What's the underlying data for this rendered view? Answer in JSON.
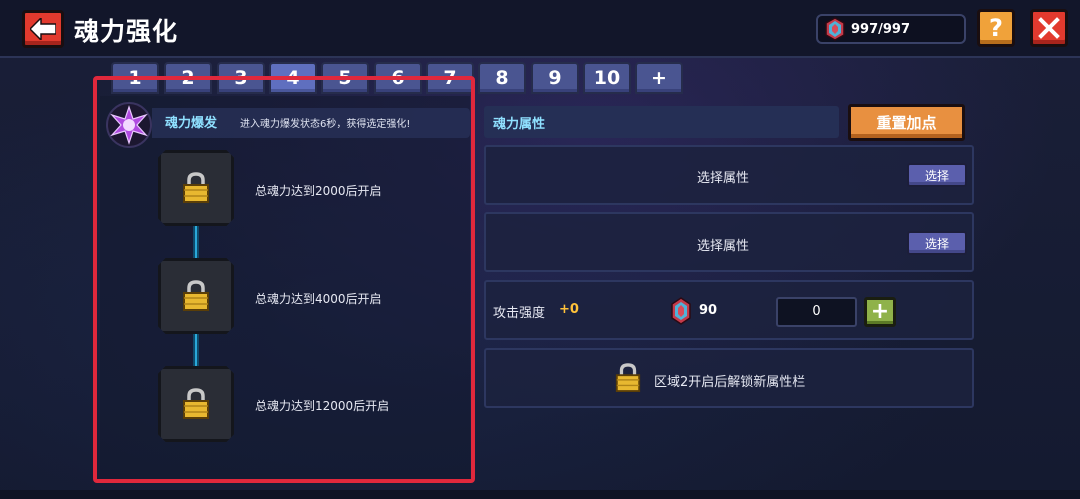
{
  "header": {
    "back_icon": "arrow-left-icon",
    "title": "魂力强化",
    "energy": "997/997",
    "energy_icon": "soul-gem-icon",
    "help_label": "?",
    "close_label": "✕"
  },
  "tabs": [
    "1",
    "2",
    "3",
    "4",
    "5",
    "6",
    "7",
    "8",
    "9",
    "10",
    "+"
  ],
  "active_tab": "4",
  "burst": {
    "icon": "soul-burst-icon",
    "name": "魂力爆发",
    "description": "进入魂力爆发状态6秒，获得选定强化!"
  },
  "nodes": [
    {
      "label": "总魂力达到2000后开启",
      "icon": "lock-icon"
    },
    {
      "label": "总魂力达到4000后开启",
      "icon": "lock-icon"
    },
    {
      "label": "总魂力达到12000后开启",
      "icon": "lock-icon"
    }
  ],
  "attributes": {
    "header": "魂力属性",
    "reset_label": "重置加点",
    "slot1_text": "选择属性",
    "slot1_button": "选择",
    "slot2_text": "选择属性",
    "slot2_button": "选择",
    "attack_label": "攻击强度",
    "attack_bonus": "+0",
    "cost": "90",
    "quantity": "0",
    "plus_label": "+",
    "locked_text": "区域2开启后解锁新属性栏"
  },
  "colors": {
    "accent_cyan": "#8fe0ff",
    "highlight_red": "#e0283c",
    "bonus_yellow": "#ffc23a"
  }
}
